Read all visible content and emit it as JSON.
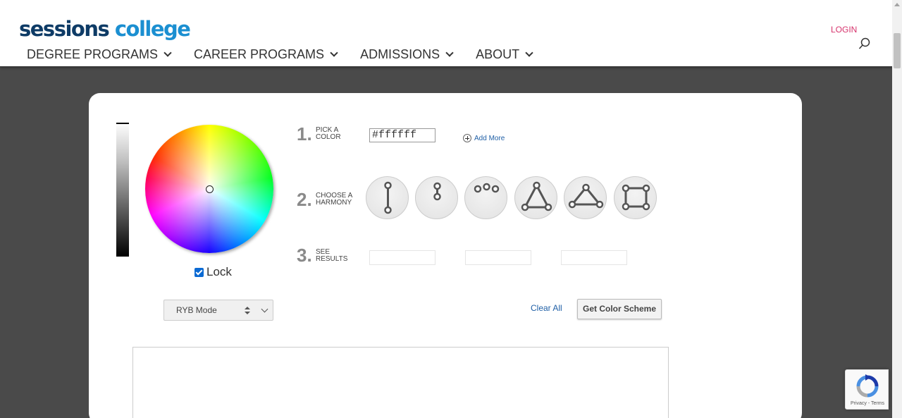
{
  "brand": {
    "name_part1": "sessions",
    "name_part2": "college"
  },
  "nav": {
    "items": [
      {
        "label": "DEGREE PROGRAMS"
      },
      {
        "label": "CAREER PROGRAMS"
      },
      {
        "label": "ADMISSIONS"
      },
      {
        "label": "ABOUT"
      }
    ],
    "login_label": "LOGIN"
  },
  "picker": {
    "lock_label": "Lock",
    "lock_checked": true,
    "steps": [
      {
        "number": "1.",
        "label_line1": "PICK A",
        "label_line2": "COLOR"
      },
      {
        "number": "2.",
        "label_line1": "CHOOSE A",
        "label_line2": "HARMONY"
      },
      {
        "number": "3.",
        "label_line1": "SEE",
        "label_line2": "RESULTS"
      }
    ],
    "color_value": "#ffffff",
    "add_more_label": "Add More",
    "harmonies": [
      "complementary-icon",
      "split-icon",
      "analogous-icon",
      "triad-icon",
      "triangle-icon",
      "tetrad-icon"
    ],
    "mode_selected": "RYB Mode",
    "clear_all_label": "Clear All",
    "get_scheme_label": "Get Color Scheme"
  },
  "recaptcha": {
    "terms_text": "Privacy - Terms"
  },
  "colors": {
    "brand_dark": "#0e3b66",
    "brand_light": "#1b8fd1",
    "login": "#d6336c",
    "link": "#1f5fa6",
    "page_bg": "#4a4a4a"
  }
}
